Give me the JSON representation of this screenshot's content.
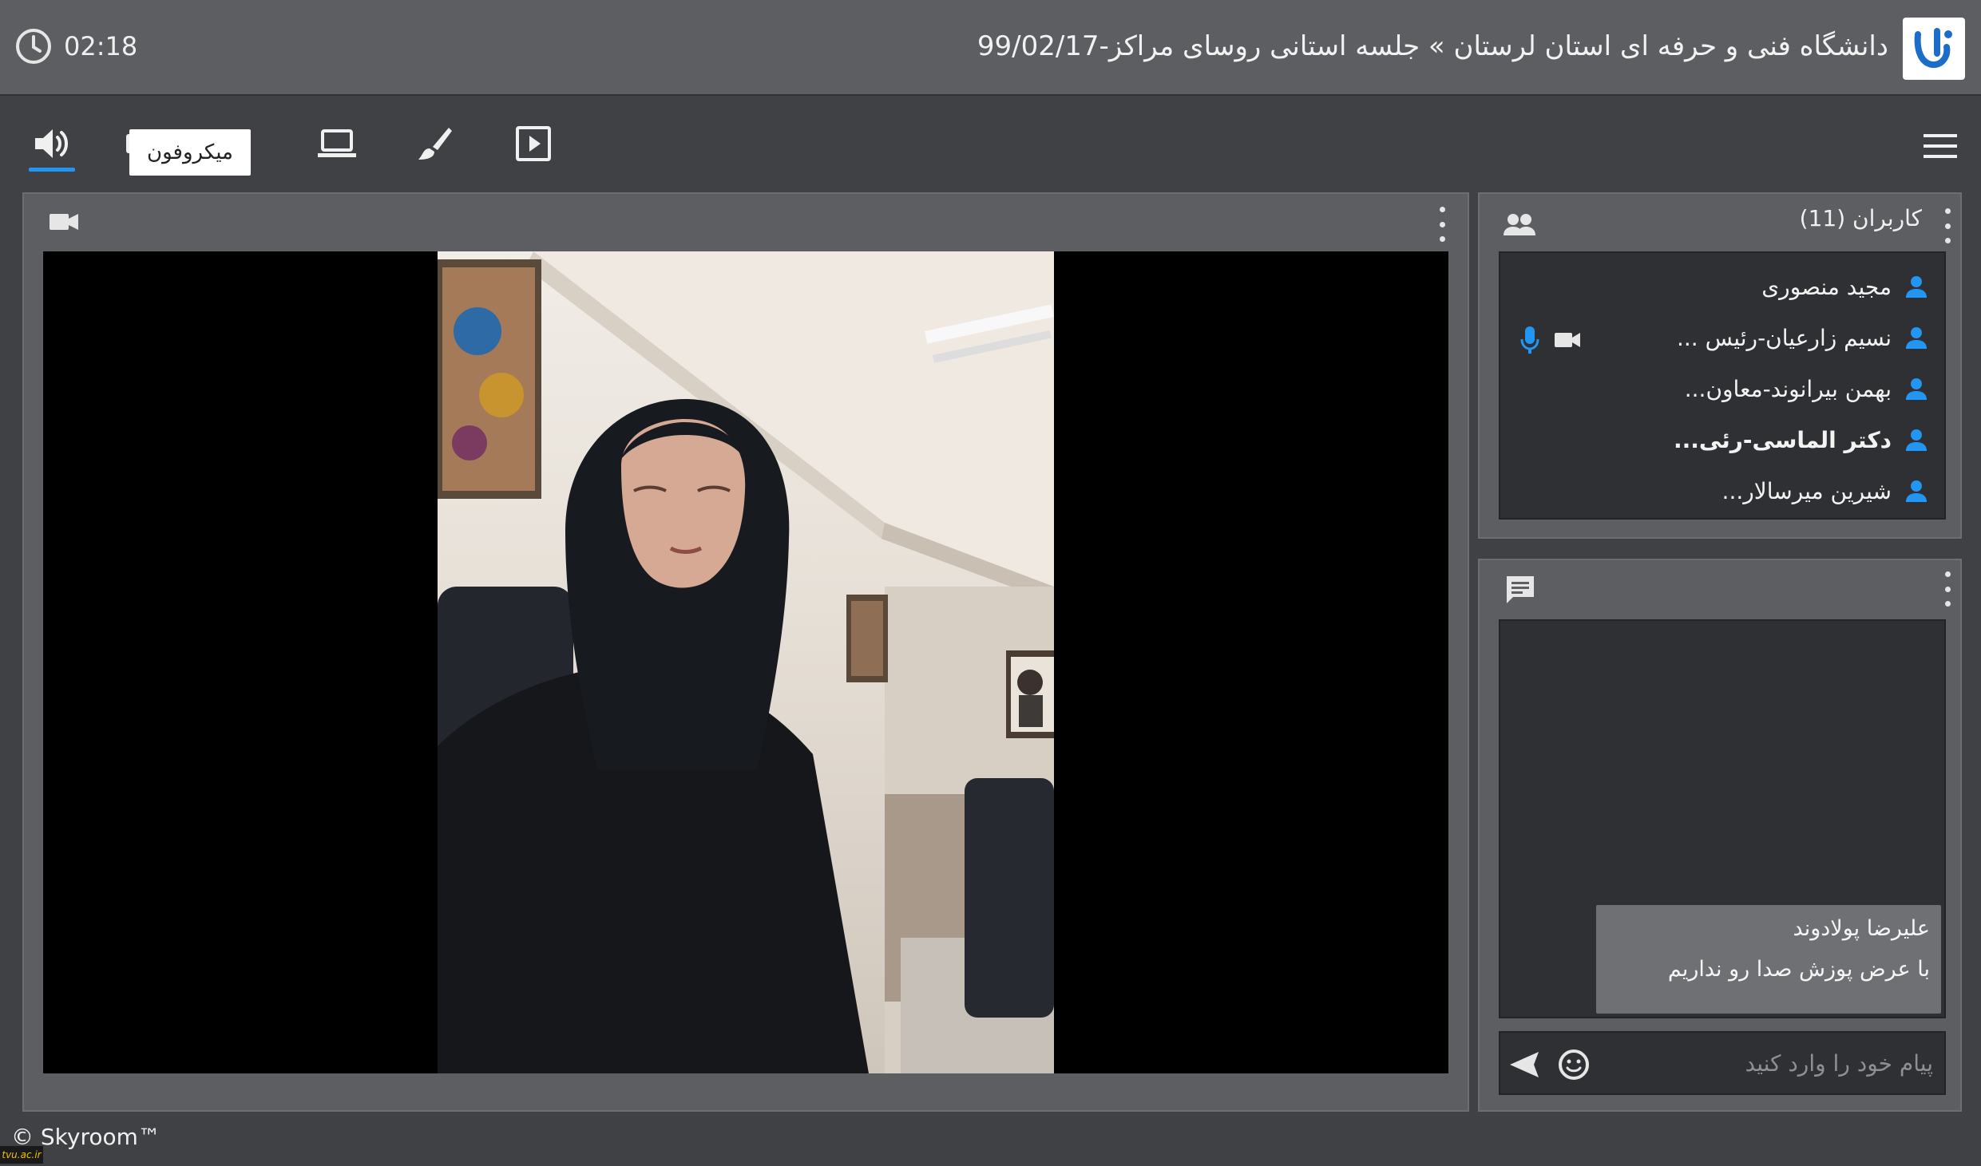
{
  "header": {
    "clock": "02:18",
    "title": "دانشگاه فنی و حرفه ای استان لرستان » جلسه استانی روسای مراکز-99/02/17",
    "logo": "university-logo"
  },
  "toolbar": {
    "tools": [
      "speaker-icon",
      "camera-icon",
      "screen-share-icon",
      "brush-icon",
      "play-icon"
    ],
    "active_tool": "speaker",
    "tooltip": "میکروفون",
    "accent_color": "#2196f3"
  },
  "video": {
    "header_icon": "video-camera-icon"
  },
  "users": {
    "title": "کاربران (11)",
    "list": [
      {
        "name": "مجید منصوری",
        "bold": false
      },
      {
        "name": "نسیم زارعیان-رئیس ...",
        "bold": false,
        "mic": true,
        "cam": true
      },
      {
        "name": "بهمن بیرانوند-معاون...",
        "bold": false
      },
      {
        "name": "دکتر الماسی-رئی...",
        "bold": true
      },
      {
        "name": "شیرین میرسالار...",
        "bold": false
      }
    ]
  },
  "chat": {
    "messages": [
      {
        "author": "علیرضا پولادوند",
        "text": "با عرض پوزش صدا رو نداریم"
      }
    ],
    "placeholder": "پیام خود را وارد کنید"
  },
  "footer": {
    "copyright": "© Skyroom™",
    "badge": "tvu.ac.ir"
  }
}
